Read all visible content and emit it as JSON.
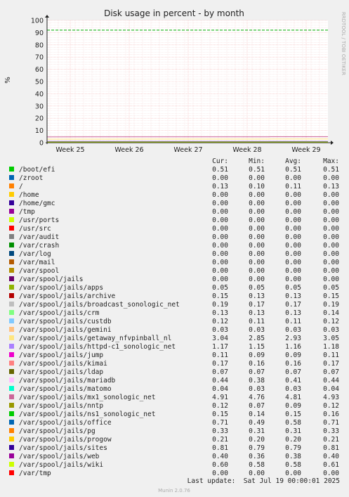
{
  "chart_data": {
    "type": "line",
    "title": "Disk usage in percent - by month",
    "ylabel": "%",
    "xlabel": "",
    "ylim": [
      0,
      100
    ],
    "y_ticks": [
      0,
      10,
      20,
      30,
      40,
      50,
      60,
      70,
      80,
      90,
      100
    ],
    "x_ticks": [
      "Week 25",
      "Week 26",
      "Week 27",
      "Week 28",
      "Week 29"
    ],
    "grid": true,
    "warning_line": 92,
    "legend_headers": {
      "cur": "Cur:",
      "min": "Min:",
      "avg": "Avg:",
      "max": "Max:"
    },
    "series": [
      {
        "name": "/boot/efi",
        "color": "#00cc00",
        "cur": "0.51",
        "min": "0.51",
        "avg": "0.51",
        "max": "0.51"
      },
      {
        "name": "/zroot",
        "color": "#0066b3",
        "cur": "0.00",
        "min": "0.00",
        "avg": "0.00",
        "max": "0.00"
      },
      {
        "name": "/",
        "color": "#ff8000",
        "cur": "0.13",
        "min": "0.10",
        "avg": "0.11",
        "max": "0.13"
      },
      {
        "name": "/home",
        "color": "#ffcc00",
        "cur": "0.00",
        "min": "0.00",
        "avg": "0.00",
        "max": "0.00"
      },
      {
        "name": "/home/gmc",
        "color": "#330099",
        "cur": "0.00",
        "min": "0.00",
        "avg": "0.00",
        "max": "0.00"
      },
      {
        "name": "/tmp",
        "color": "#990099",
        "cur": "0.00",
        "min": "0.00",
        "avg": "0.00",
        "max": "0.00"
      },
      {
        "name": "/usr/ports",
        "color": "#ccff00",
        "cur": "0.00",
        "min": "0.00",
        "avg": "0.00",
        "max": "0.00"
      },
      {
        "name": "/usr/src",
        "color": "#ff0000",
        "cur": "0.00",
        "min": "0.00",
        "avg": "0.00",
        "max": "0.00"
      },
      {
        "name": "/var/audit",
        "color": "#808080",
        "cur": "0.00",
        "min": "0.00",
        "avg": "0.00",
        "max": "0.00"
      },
      {
        "name": "/var/crash",
        "color": "#008f00",
        "cur": "0.00",
        "min": "0.00",
        "avg": "0.00",
        "max": "0.00"
      },
      {
        "name": "/var/log",
        "color": "#00487d",
        "cur": "0.00",
        "min": "0.00",
        "avg": "0.00",
        "max": "0.00"
      },
      {
        "name": "/var/mail",
        "color": "#b35a00",
        "cur": "0.00",
        "min": "0.00",
        "avg": "0.00",
        "max": "0.00"
      },
      {
        "name": "/var/spool",
        "color": "#b38f00",
        "cur": "0.00",
        "min": "0.00",
        "avg": "0.00",
        "max": "0.00"
      },
      {
        "name": "/var/spool/jails",
        "color": "#6b006b",
        "cur": "0.00",
        "min": "0.00",
        "avg": "0.00",
        "max": "0.00"
      },
      {
        "name": "/var/spool/jails/apps",
        "color": "#8fb300",
        "cur": "0.05",
        "min": "0.05",
        "avg": "0.05",
        "max": "0.05"
      },
      {
        "name": "/var/spool/jails/archive",
        "color": "#b30000",
        "cur": "0.15",
        "min": "0.13",
        "avg": "0.13",
        "max": "0.15"
      },
      {
        "name": "/var/spool/jails/broadcast_sonologic_net",
        "color": "#bebebe",
        "cur": "0.19",
        "min": "0.17",
        "avg": "0.17",
        "max": "0.19"
      },
      {
        "name": "/var/spool/jails/crm",
        "color": "#80ff80",
        "cur": "0.13",
        "min": "0.13",
        "avg": "0.13",
        "max": "0.14"
      },
      {
        "name": "/var/spool/jails/custdb",
        "color": "#80c9ff",
        "cur": "0.12",
        "min": "0.11",
        "avg": "0.11",
        "max": "0.12"
      },
      {
        "name": "/var/spool/jails/gemini",
        "color": "#ffc080",
        "cur": "0.03",
        "min": "0.03",
        "avg": "0.03",
        "max": "0.03"
      },
      {
        "name": "/var/spool/jails/getaway_nfvpinball_nl",
        "color": "#ffe680",
        "cur": "3.04",
        "min": "2.85",
        "avg": "2.93",
        "max": "3.05"
      },
      {
        "name": "/var/spool/jails/httpd-c1_sonologic_net",
        "color": "#aa80ff",
        "cur": "1.17",
        "min": "1.15",
        "avg": "1.16",
        "max": "1.18"
      },
      {
        "name": "/var/spool/jails/jump",
        "color": "#ee00cc",
        "cur": "0.11",
        "min": "0.09",
        "avg": "0.09",
        "max": "0.11"
      },
      {
        "name": "/var/spool/jails/kimai",
        "color": "#ff8080",
        "cur": "0.17",
        "min": "0.16",
        "avg": "0.16",
        "max": "0.17"
      },
      {
        "name": "/var/spool/jails/ldap",
        "color": "#666600",
        "cur": "0.07",
        "min": "0.07",
        "avg": "0.07",
        "max": "0.07"
      },
      {
        "name": "/var/spool/jails/mariadb",
        "color": "#ffbfff",
        "cur": "0.44",
        "min": "0.38",
        "avg": "0.41",
        "max": "0.44"
      },
      {
        "name": "/var/spool/jails/matomo",
        "color": "#00ffcc",
        "cur": "0.04",
        "min": "0.03",
        "avg": "0.03",
        "max": "0.04"
      },
      {
        "name": "/var/spool/jails/mx1_sonologic_net",
        "color": "#cc6699",
        "cur": "4.91",
        "min": "4.76",
        "avg": "4.81",
        "max": "4.93"
      },
      {
        "name": "/var/spool/jails/nntp",
        "color": "#999900",
        "cur": "0.12",
        "min": "0.07",
        "avg": "0.09",
        "max": "0.12"
      },
      {
        "name": "/var/spool/jails/ns1_sonologic_net",
        "color": "#00cc00",
        "cur": "0.15",
        "min": "0.14",
        "avg": "0.15",
        "max": "0.16"
      },
      {
        "name": "/var/spool/jails/office",
        "color": "#0066b3",
        "cur": "0.71",
        "min": "0.49",
        "avg": "0.58",
        "max": "0.71"
      },
      {
        "name": "/var/spool/jails/pg",
        "color": "#ff8000",
        "cur": "0.33",
        "min": "0.31",
        "avg": "0.31",
        "max": "0.33"
      },
      {
        "name": "/var/spool/jails/progow",
        "color": "#ffcc00",
        "cur": "0.21",
        "min": "0.20",
        "avg": "0.20",
        "max": "0.21"
      },
      {
        "name": "/var/spool/jails/sites",
        "color": "#330099",
        "cur": "0.81",
        "min": "0.79",
        "avg": "0.79",
        "max": "0.81"
      },
      {
        "name": "/var/spool/jails/web",
        "color": "#990099",
        "cur": "0.40",
        "min": "0.36",
        "avg": "0.38",
        "max": "0.40"
      },
      {
        "name": "/var/spool/jails/wiki",
        "color": "#ccff00",
        "cur": "0.60",
        "min": "0.58",
        "avg": "0.58",
        "max": "0.61"
      },
      {
        "name": "/var/tmp",
        "color": "#ff0000",
        "cur": "0.00",
        "min": "0.00",
        "avg": "0.00",
        "max": "0.00"
      }
    ]
  },
  "last_update": "Last update:  Sat Jul 19 00:00:01 2025",
  "side_label": "RRDTOOL / TOBI OETIKER",
  "footer": "Munin 2.0.76",
  "colors": {
    "background": "#f0f0f0",
    "plot": "#ffffff",
    "grid": "#ffaaaa",
    "warning": "#00aa00"
  }
}
